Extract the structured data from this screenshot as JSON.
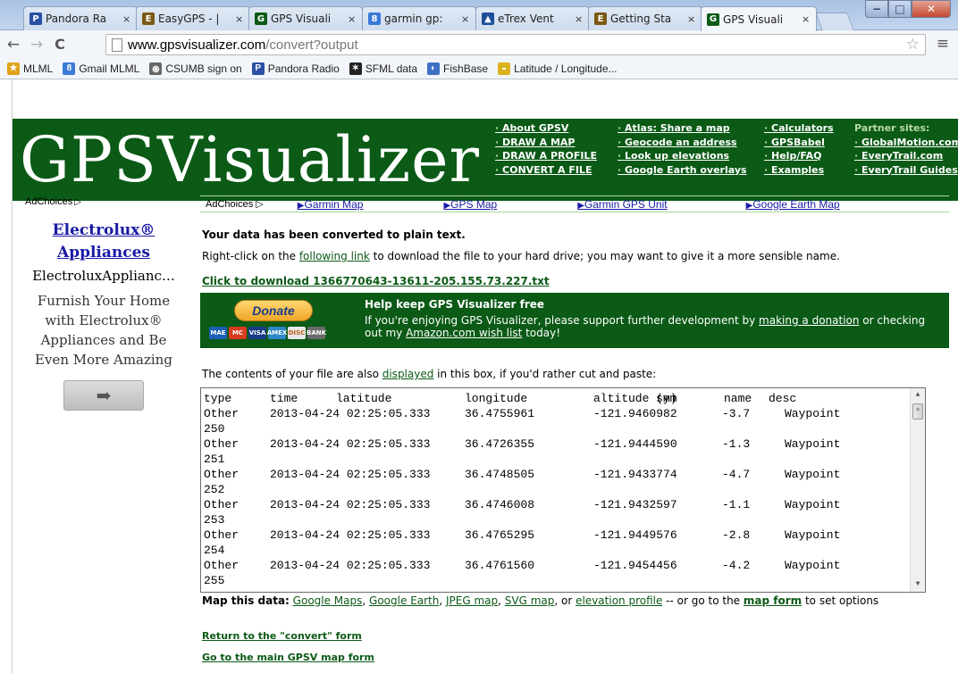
{
  "browser": {
    "tabs": [
      {
        "title": "Pandora Ra",
        "favicon": "pandora-icon",
        "favicon_text": "P",
        "favicon_color": "#2a4fa4",
        "active": false
      },
      {
        "title": "EasyGPS - |",
        "favicon": "easygps-icon",
        "favicon_text": "E",
        "favicon_color": "#7a5a14",
        "active": false
      },
      {
        "title": "GPS Visuali",
        "favicon": "gpsv-icon",
        "favicon_text": "G",
        "favicon_color": "#0b5a16",
        "active": false
      },
      {
        "title": "garmin gp:",
        "favicon": "google-icon",
        "favicon_text": "8",
        "favicon_color": "#3b7bd8",
        "active": false
      },
      {
        "title": "eTrex Vent",
        "favicon": "garmin-icon",
        "favicon_text": "▲",
        "favicon_color": "#1d4f9a",
        "active": false
      },
      {
        "title": "Getting Sta",
        "favicon": "easygps-icon",
        "favicon_text": "E",
        "favicon_color": "#7a5a14",
        "active": false
      },
      {
        "title": "GPS Visuali",
        "favicon": "gpsv-icon",
        "favicon_text": "G",
        "favicon_color": "#0b5a16",
        "active": true
      }
    ],
    "tab_close": "×",
    "window_buttons": {
      "minimize": "−",
      "maximize": "□",
      "close": "✕"
    },
    "nav": {
      "back": "←",
      "forward": "→",
      "reload": "C"
    },
    "url_domain": "www.gpsvisualizer.com",
    "url_path": "/convert?output",
    "star": "☆",
    "menu": "≡",
    "bookmarks": [
      {
        "label": "MLML",
        "icon": "folder-icon",
        "icon_text": "★",
        "color": "#e0a21c"
      },
      {
        "label": "Gmail MLML",
        "icon": "google-icon",
        "icon_text": "8",
        "color": "#3b7bd8"
      },
      {
        "label": "CSUMB sign on",
        "icon": "csumb-icon",
        "icon_text": "֍",
        "color": "#666666"
      },
      {
        "label": "Pandora Radio",
        "icon": "pandora-icon",
        "icon_text": "P",
        "color": "#2a4fa4"
      },
      {
        "label": "SFML data",
        "icon": "sfml-icon",
        "icon_text": "✶",
        "color": "#222222"
      },
      {
        "label": "FishBase",
        "icon": "fishbase-icon",
        "icon_text": "◐",
        "color": "#3f6fc2"
      },
      {
        "label": "Latitude / Longitude...",
        "icon": "globe-icon",
        "icon_text": "◒",
        "color": "#d9b21c"
      }
    ]
  },
  "site": {
    "logo_gps": "GPS",
    "logo_visualizer": "Visualizer",
    "nav_col1": [
      "About GPSV",
      "DRAW A MAP",
      "DRAW A PROFILE",
      "CONVERT A FILE"
    ],
    "nav_col2": [
      "Atlas: Share a map",
      "Geocode an address",
      "Look up elevations",
      "Google Earth overlays"
    ],
    "nav_col3": [
      "Calculators",
      "GPSBabel",
      "Help/FAQ",
      "Examples"
    ],
    "partner_heading": "Partner sites:",
    "nav_col4": [
      "GlobalMotion.com",
      "EveryTrail.com",
      "EveryTrail Guides"
    ],
    "ad_choices": "AdChoices",
    "ad_links": [
      "Garmin Map",
      "GPS Map",
      "Garmin GPS Unit",
      "Google Earth Map"
    ],
    "side_ad": {
      "title_line1": "Electrolux®",
      "title_line2": "Appliances",
      "domain": "ElectroluxApplianc…",
      "text": "Furnish Your Home with Electrolux® Appliances and Be Even More Amazing",
      "arrow": "➡"
    }
  },
  "content": {
    "heading": "Your data has been converted to plain text.",
    "instr_pre": "Right-click on the ",
    "instr_link": "following link",
    "instr_post": " to download the file to your hard drive; you may want to give it a more sensible name.",
    "download_link": "Click to download 1366770643-13611-205.155.73.227.txt",
    "donate_button": "Donate",
    "donate_title": "Help keep GPS Visualizer free",
    "donate_pre": "If you're enjoying GPS Visualizer, please support further development by ",
    "donate_link1": "making a donation",
    "donate_mid": " or checking out my ",
    "donate_link2": "Amazon.com wish list",
    "donate_post": " today!",
    "cards": [
      {
        "label": "MAE",
        "color": "#1a5fb4"
      },
      {
        "label": "MC",
        "color": "#d93a1f"
      },
      {
        "label": "VISA",
        "color": "#1a3d89"
      },
      {
        "label": "AMEX",
        "color": "#2d87c8"
      },
      {
        "label": "DISC",
        "color": "#e8e8e8"
      },
      {
        "label": "BANK",
        "color": "#6a6a6a"
      }
    ],
    "contents_pre": "The contents of your file are also ",
    "contents_link": "displayed",
    "contents_post": " in this box, if you'd rather cut and paste:",
    "file_header": [
      "type",
      "time",
      "latitude",
      "longitude",
      "altitude (m)",
      "sym",
      "name",
      "desc"
    ],
    "file_rows": [
      {
        "type": "Other",
        "time": "2013-04-24 02:25:05.333",
        "lat": "36.4755961",
        "lon": "-121.9460982",
        "alt": "-3.7",
        "sym": "Waypoint",
        "desc": "",
        "id": "250"
      },
      {
        "type": "Other",
        "time": "2013-04-24 02:25:05.333",
        "lat": "36.4726355",
        "lon": "-121.9444590",
        "alt": "-1.3",
        "sym": "Waypoint",
        "desc": "",
        "id": "251"
      },
      {
        "type": "Other",
        "time": "2013-04-24 02:25:05.333",
        "lat": "36.4748505",
        "lon": "-121.9433774",
        "alt": "-4.7",
        "sym": "Waypoint",
        "desc": "",
        "id": "252"
      },
      {
        "type": "Other",
        "time": "2013-04-24 02:25:05.333",
        "lat": "36.4746008",
        "lon": "-121.9432597",
        "alt": "-1.1",
        "sym": "Waypoint",
        "desc": "",
        "id": "253"
      },
      {
        "type": "Other",
        "time": "2013-04-24 02:25:05.333",
        "lat": "36.4765295",
        "lon": "-121.9449576",
        "alt": "-2.8",
        "sym": "Waypoint",
        "desc": "",
        "id": "254"
      },
      {
        "type": "Other",
        "time": "2013-04-24 02:25:05.333",
        "lat": "36.4761560",
        "lon": "-121.9454456",
        "alt": "-4.2",
        "sym": "Waypoint",
        "desc": "",
        "id": "255"
      }
    ],
    "map_label": "Map this data:",
    "map_links": [
      "Google Maps",
      "Google Earth",
      "JPEG map",
      "SVG map",
      "elevation profile"
    ],
    "map_sep1": ", ",
    "map_or": ", or ",
    "map_mid": " -- or go to the ",
    "map_form_link": "map form",
    "map_post": " to set options",
    "return_link": "Return to the \"convert\" form",
    "main_link": "Go to the main GPSV map form"
  },
  "colors": {
    "gpsv_green": "#0b5a16",
    "ad_link_blue": "#1a1aa6"
  }
}
